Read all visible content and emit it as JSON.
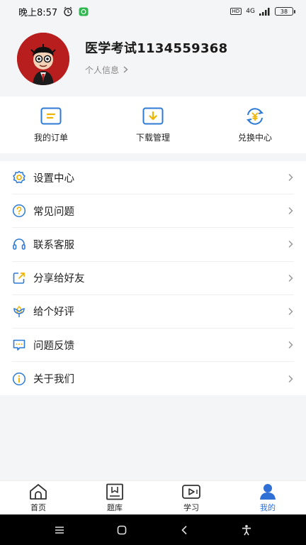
{
  "status_bar": {
    "time": "晚上8:57",
    "hd": "HD",
    "network": "4G",
    "battery": "38"
  },
  "profile": {
    "username": "医学考试1134559368",
    "personal_info": "个人信息"
  },
  "quick_actions": [
    {
      "label": "我的订单",
      "icon": "order-icon"
    },
    {
      "label": "下载管理",
      "icon": "download-icon"
    },
    {
      "label": "兑换中心",
      "icon": "exchange-icon"
    }
  ],
  "menu": [
    {
      "label": "设置中心",
      "icon": "settings-icon"
    },
    {
      "label": "常见问题",
      "icon": "question-icon"
    },
    {
      "label": "联系客服",
      "icon": "headset-icon"
    },
    {
      "label": "分享给好友",
      "icon": "share-icon"
    },
    {
      "label": "给个好评",
      "icon": "flower-icon"
    },
    {
      "label": "问题反馈",
      "icon": "feedback-icon"
    },
    {
      "label": "关于我们",
      "icon": "info-icon"
    }
  ],
  "tabbar": [
    {
      "label": "首页",
      "icon": "home-icon",
      "active": false
    },
    {
      "label": "题库",
      "icon": "question-bank-icon",
      "active": false
    },
    {
      "label": "学习",
      "icon": "study-icon",
      "active": false
    },
    {
      "label": "我的",
      "icon": "profile-icon",
      "active": true
    }
  ],
  "colors": {
    "accent": "#2f6fd6",
    "icon_blue": "#2e7ad4",
    "avatar_bg": "#b81e1e"
  }
}
